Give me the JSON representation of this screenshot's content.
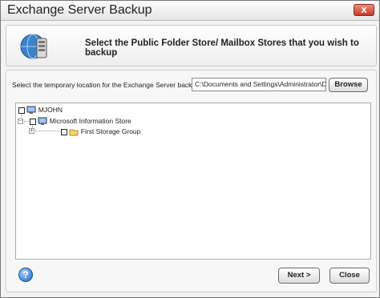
{
  "window": {
    "title": "Exchange Server Backup",
    "close_glyph": "x"
  },
  "header": {
    "headline": "Select the Public Folder Store/ Mailbox Stores that you wish to backup",
    "icon": "exchange-server-icon"
  },
  "location": {
    "label": "Select the temporary location for the Exchange Server backup:",
    "value": "C:\\Documents and Settings\\Administrator\\Deskt",
    "browse_label": "Browse"
  },
  "tree": {
    "root": {
      "label": "MJOHN",
      "checked": false
    },
    "store": {
      "label": "Microsoft Information Store",
      "checked": false,
      "expander": "−"
    },
    "group": {
      "label": "First Storage Group",
      "checked": false,
      "expander": "+"
    }
  },
  "footer": {
    "help_glyph": "?",
    "next_label": "Next >",
    "close_label": "Close"
  }
}
